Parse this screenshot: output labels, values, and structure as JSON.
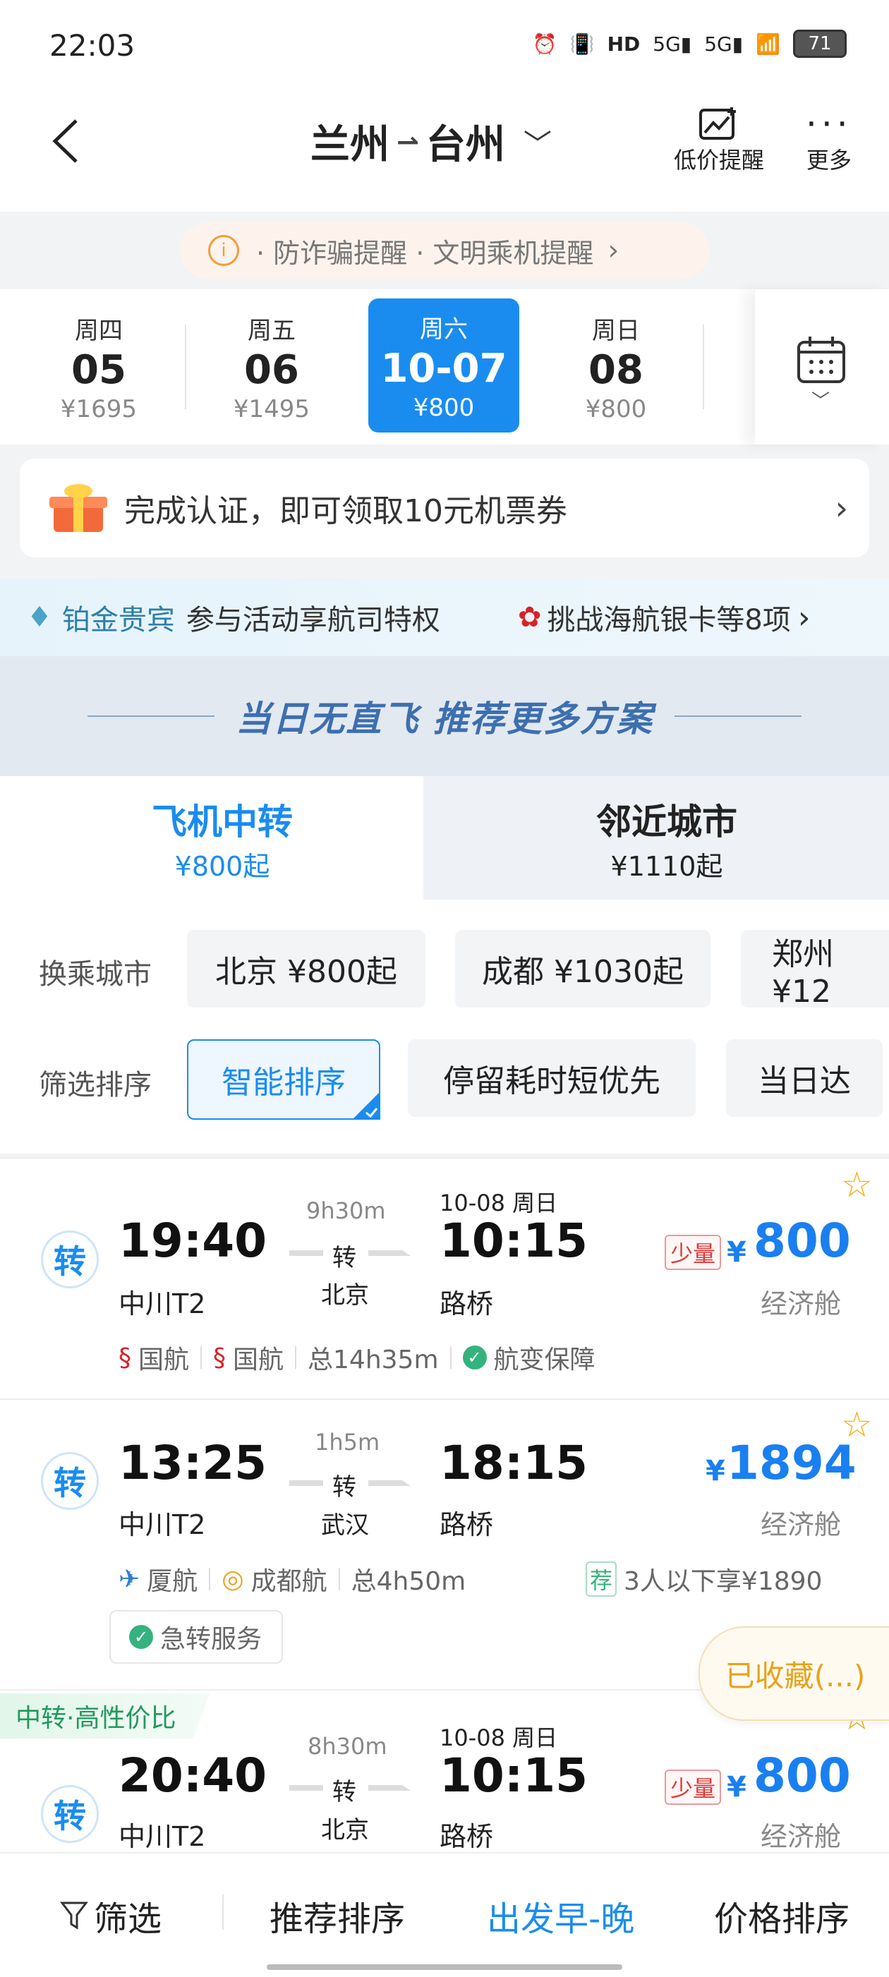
{
  "status_bar": {
    "time": "22:03",
    "battery": "71",
    "icons": [
      "alarm-icon",
      "vibrate-icon",
      "hd-icon",
      "signal-5g-icon",
      "signal-5g-icon",
      "wifi-icon",
      "battery-icon"
    ]
  },
  "header": {
    "from": "兰州",
    "to": "台州",
    "price_alert_label": "低价提醒",
    "more_label": "更多"
  },
  "notice": {
    "text": "· 防诈骗提醒 · 文明乘机提醒"
  },
  "dates": [
    {
      "weekday": "周四",
      "day": "05",
      "price": "¥1695"
    },
    {
      "weekday": "周五",
      "day": "06",
      "price": "¥1495"
    },
    {
      "weekday": "周六",
      "day": "10-07",
      "price": "¥800",
      "selected": true
    },
    {
      "weekday": "周日",
      "day": "08",
      "price": "¥800"
    }
  ],
  "banner": {
    "text": "完成认证，即可领取10元机票券"
  },
  "member": {
    "tier": "铂金贵宾",
    "desc": "参与活动享航司特权",
    "promo": "挑战海航银卡等8项"
  },
  "no_direct": {
    "text": "当日无直飞  推荐更多方案"
  },
  "tabs": [
    {
      "title": "飞机中转",
      "sub": "¥800起",
      "active": true
    },
    {
      "title": "邻近城市",
      "sub": "¥1110起",
      "active": false
    }
  ],
  "transfer_row": {
    "label": "换乘城市",
    "chips": [
      "北京 ¥800起",
      "成都 ¥1030起",
      "郑州 ¥12"
    ]
  },
  "sort_row": {
    "label": "筛选排序",
    "chips": [
      "智能排序",
      "停留耗时短优先",
      "当日达"
    ]
  },
  "flights": [
    {
      "badge": "转",
      "dep_time": "19:40",
      "dep_airport": "中川T2",
      "duration": "9h30m",
      "transfer_label": "转",
      "transfer_city": "北京",
      "arr_date": "10-08 周日",
      "arr_time": "10:15",
      "arr_airport": "路桥",
      "few": "少量",
      "yen": "¥",
      "price": "800",
      "cabin": "经济舱",
      "airline1": "国航",
      "airline2": "国航",
      "total": "总14h35m",
      "guarantee": "航变保障"
    },
    {
      "badge": "转",
      "dep_time": "13:25",
      "dep_airport": "中川T2",
      "duration": "1h5m",
      "transfer_label": "转",
      "transfer_city": "武汉",
      "arr_time": "18:15",
      "arr_airport": "路桥",
      "yen": "¥",
      "price": "1894",
      "cabin": "经济舱",
      "airline1": "厦航",
      "airline2": "成都航",
      "total": "总4h50m",
      "rec_tag": "荐",
      "rec_text": "3人以下享¥1890",
      "service": "急转服务"
    },
    {
      "tag": "中转·高性价比",
      "badge": "转",
      "dep_time": "20:40",
      "dep_airport": "中川T2",
      "duration": "8h30m",
      "transfer_label": "转",
      "transfer_city": "北京",
      "arr_date": "10-08 周日",
      "arr_time": "10:15",
      "arr_airport": "路桥",
      "few": "少量",
      "yen": "¥",
      "price": "800",
      "cabin": "经济舱"
    }
  ],
  "favorite_float": "已收藏(...)",
  "bottom_bar": [
    "筛选",
    "推荐排序",
    "出发早-晚",
    "价格排序"
  ],
  "colors": {
    "accent": "#1a8cf0",
    "price": "#1a7ff0",
    "star": "#f2b01e"
  }
}
